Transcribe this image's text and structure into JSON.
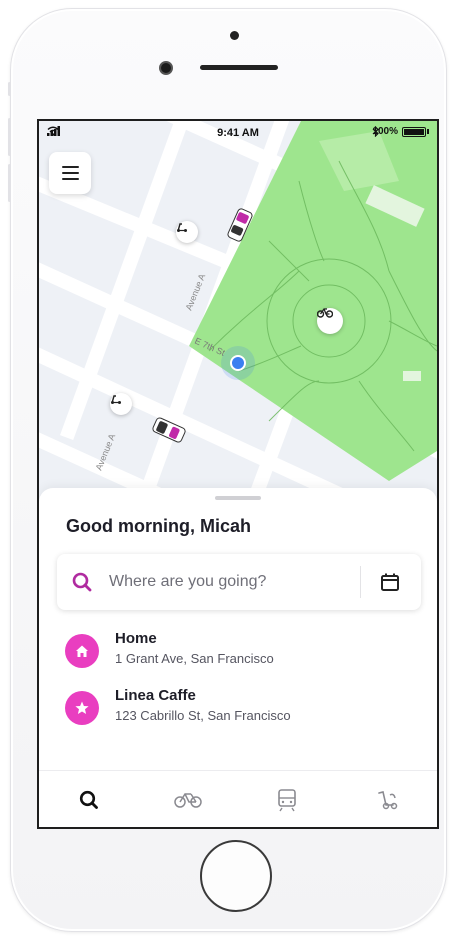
{
  "status_bar": {
    "time": "9:41 AM",
    "battery": "100%"
  },
  "map": {
    "streets": [
      "Avenue A",
      "E 7th St",
      "Avenue A"
    ],
    "vehicle_icons": [
      "scooter-icon",
      "car-icon",
      "bike-icon",
      "scooter-icon",
      "car-icon"
    ],
    "park_color": "#9ee58e",
    "location_color": "#3b7ff0"
  },
  "sheet": {
    "greeting": "Good morning, Micah",
    "search_placeholder": "Where are you going?",
    "places": [
      {
        "title": "Home",
        "address": "1 Grant Ave, San Francisco",
        "icon": "home-icon"
      },
      {
        "title": "Linea Caffe",
        "address": "123 Cabrillo St, San Francisco",
        "icon": "star-icon"
      }
    ]
  },
  "tabs": [
    {
      "name": "search",
      "icon": "search-icon",
      "active": true
    },
    {
      "name": "bike",
      "icon": "bike-icon",
      "active": false
    },
    {
      "name": "transit",
      "icon": "train-icon",
      "active": false
    },
    {
      "name": "scooter",
      "icon": "scooter-icon",
      "active": false
    }
  ],
  "colors": {
    "accent": "#e93ec0",
    "search_accent": "#b02ba0",
    "text_dark": "#1e1e28"
  }
}
